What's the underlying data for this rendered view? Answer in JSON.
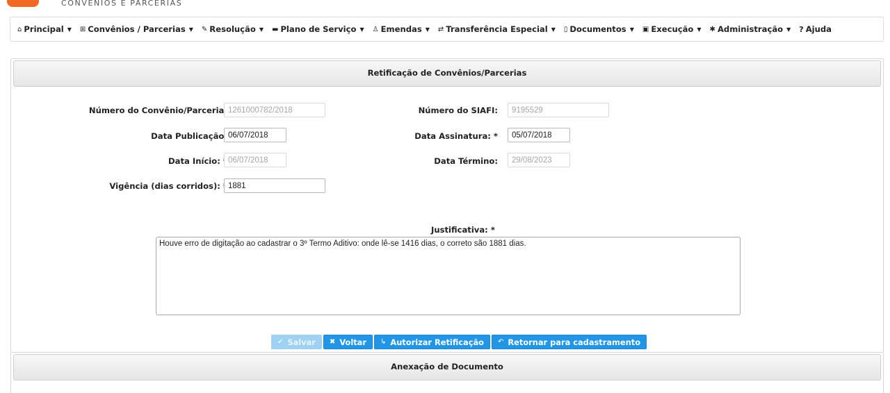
{
  "header": {
    "logo_subtitle": "CONVÊNIOS E PARCERIAS"
  },
  "nav": [
    {
      "icon": "⌂",
      "label": "Principal"
    },
    {
      "icon": "⊞",
      "label": "Convênios / Parcerias"
    },
    {
      "icon": "✎",
      "label": "Resolução"
    },
    {
      "icon": "▬",
      "label": "Plano de Serviço"
    },
    {
      "icon": "♙",
      "label": "Emendas"
    },
    {
      "icon": "⇄",
      "label": "Transferência Especial"
    },
    {
      "icon": "▯",
      "label": "Documentos"
    },
    {
      "icon": "▣",
      "label": "Execução"
    },
    {
      "icon": "✱",
      "label": "Administração"
    },
    {
      "icon": "?",
      "label": "Ajuda"
    }
  ],
  "panel": {
    "title": "Retificação de Convênios/Parcerias"
  },
  "form": {
    "numero_convenio": {
      "label": "Número do Convênio/Parceria:",
      "value": "1261000782/2018"
    },
    "numero_siafi": {
      "label": "Número do SIAFI:",
      "value": "9195529"
    },
    "data_publicacao": {
      "label": "Data Publicação:",
      "value": "06/07/2018"
    },
    "data_assinatura": {
      "label": "Data Assinatura: *",
      "value": "05/07/2018"
    },
    "data_inicio": {
      "label": "Data Início: *",
      "value": "06/07/2018"
    },
    "data_termino": {
      "label": "Data Término:",
      "value": "29/08/2023"
    },
    "vigencia": {
      "label": "Vigência (dias corridos): *",
      "value": "1881"
    },
    "justificativa": {
      "label": "Justificativa: *",
      "value": "Houve erro de digitação ao cadastrar o 3º Termo Aditivo: onde lê-se 1416 dias, o correto são 1881 dias."
    }
  },
  "buttons": {
    "salvar": "Salvar",
    "voltar": "Voltar",
    "autorizar": "Autorizar Retificação",
    "retornar": "Retornar para cadastramento"
  },
  "panel2": {
    "title": "Anexação de Documento"
  }
}
